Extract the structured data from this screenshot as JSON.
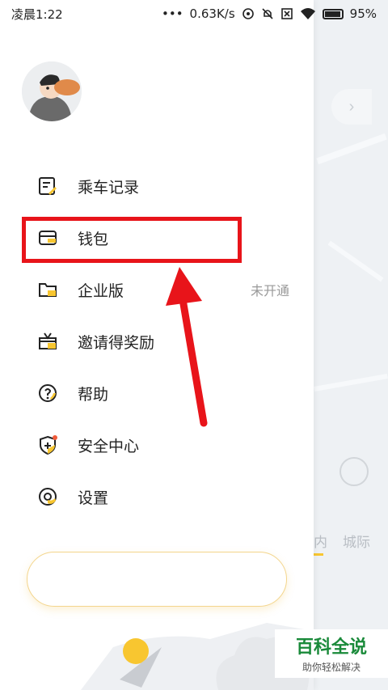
{
  "status_bar": {
    "time": "凌晨1:22",
    "network_speed": "0.63K/s",
    "battery_percent": "95%"
  },
  "menu": {
    "items": [
      {
        "label": "乘车记录",
        "icon": "ride-record-icon"
      },
      {
        "label": "钱包",
        "icon": "wallet-icon"
      },
      {
        "label": "企业版",
        "icon": "folder-icon",
        "extra": "未开通"
      },
      {
        "label": "邀请得奖励",
        "icon": "gift-icon"
      },
      {
        "label": "帮助",
        "icon": "help-icon"
      },
      {
        "label": "安全中心",
        "icon": "shield-icon"
      },
      {
        "label": "设置",
        "icon": "settings-icon"
      }
    ]
  },
  "map": {
    "tab_city": "城际",
    "tab_partial": "内"
  },
  "watermark": {
    "title": "百科全说",
    "subtitle": "助你轻松解决"
  },
  "colors": {
    "accent_yellow": "#f8c630",
    "highlight_red": "#e8141a",
    "watermark_green": "#1a8a3a"
  }
}
